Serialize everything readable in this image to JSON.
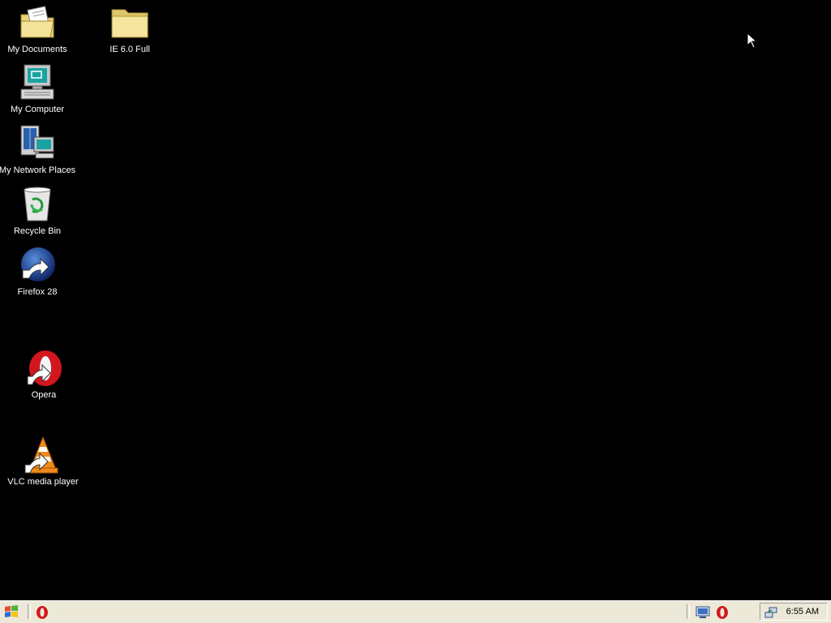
{
  "desktop": {
    "icons": [
      {
        "label": "My Documents",
        "icon": "my-documents-icon"
      },
      {
        "label": "IE 6.0 Full",
        "icon": "folder-icon"
      },
      {
        "label": "My Computer",
        "icon": "my-computer-icon"
      },
      {
        "label": "My Network Places",
        "icon": "network-places-icon"
      },
      {
        "label": "Recycle Bin",
        "icon": "recycle-bin-icon"
      },
      {
        "label": "Firefox 28",
        "icon": "firefox-shortcut-icon"
      },
      {
        "label": "Opera",
        "icon": "opera-shortcut-icon"
      },
      {
        "label": "VLC media player",
        "icon": "vlc-shortcut-icon"
      }
    ]
  },
  "taskbar": {
    "start_icon": "windows-logo-icon",
    "quick_launch": [
      "opera-icon"
    ],
    "tasks": [
      "display-icon",
      "opera-icon"
    ],
    "tray_icons": [
      "network-tray-icon"
    ],
    "clock": "6:55 AM"
  },
  "colors": {
    "desktop_bg": "#000000",
    "taskbar_bg": "#ece9d8",
    "label_text": "#ffffff",
    "opera_red": "#d2161e"
  }
}
